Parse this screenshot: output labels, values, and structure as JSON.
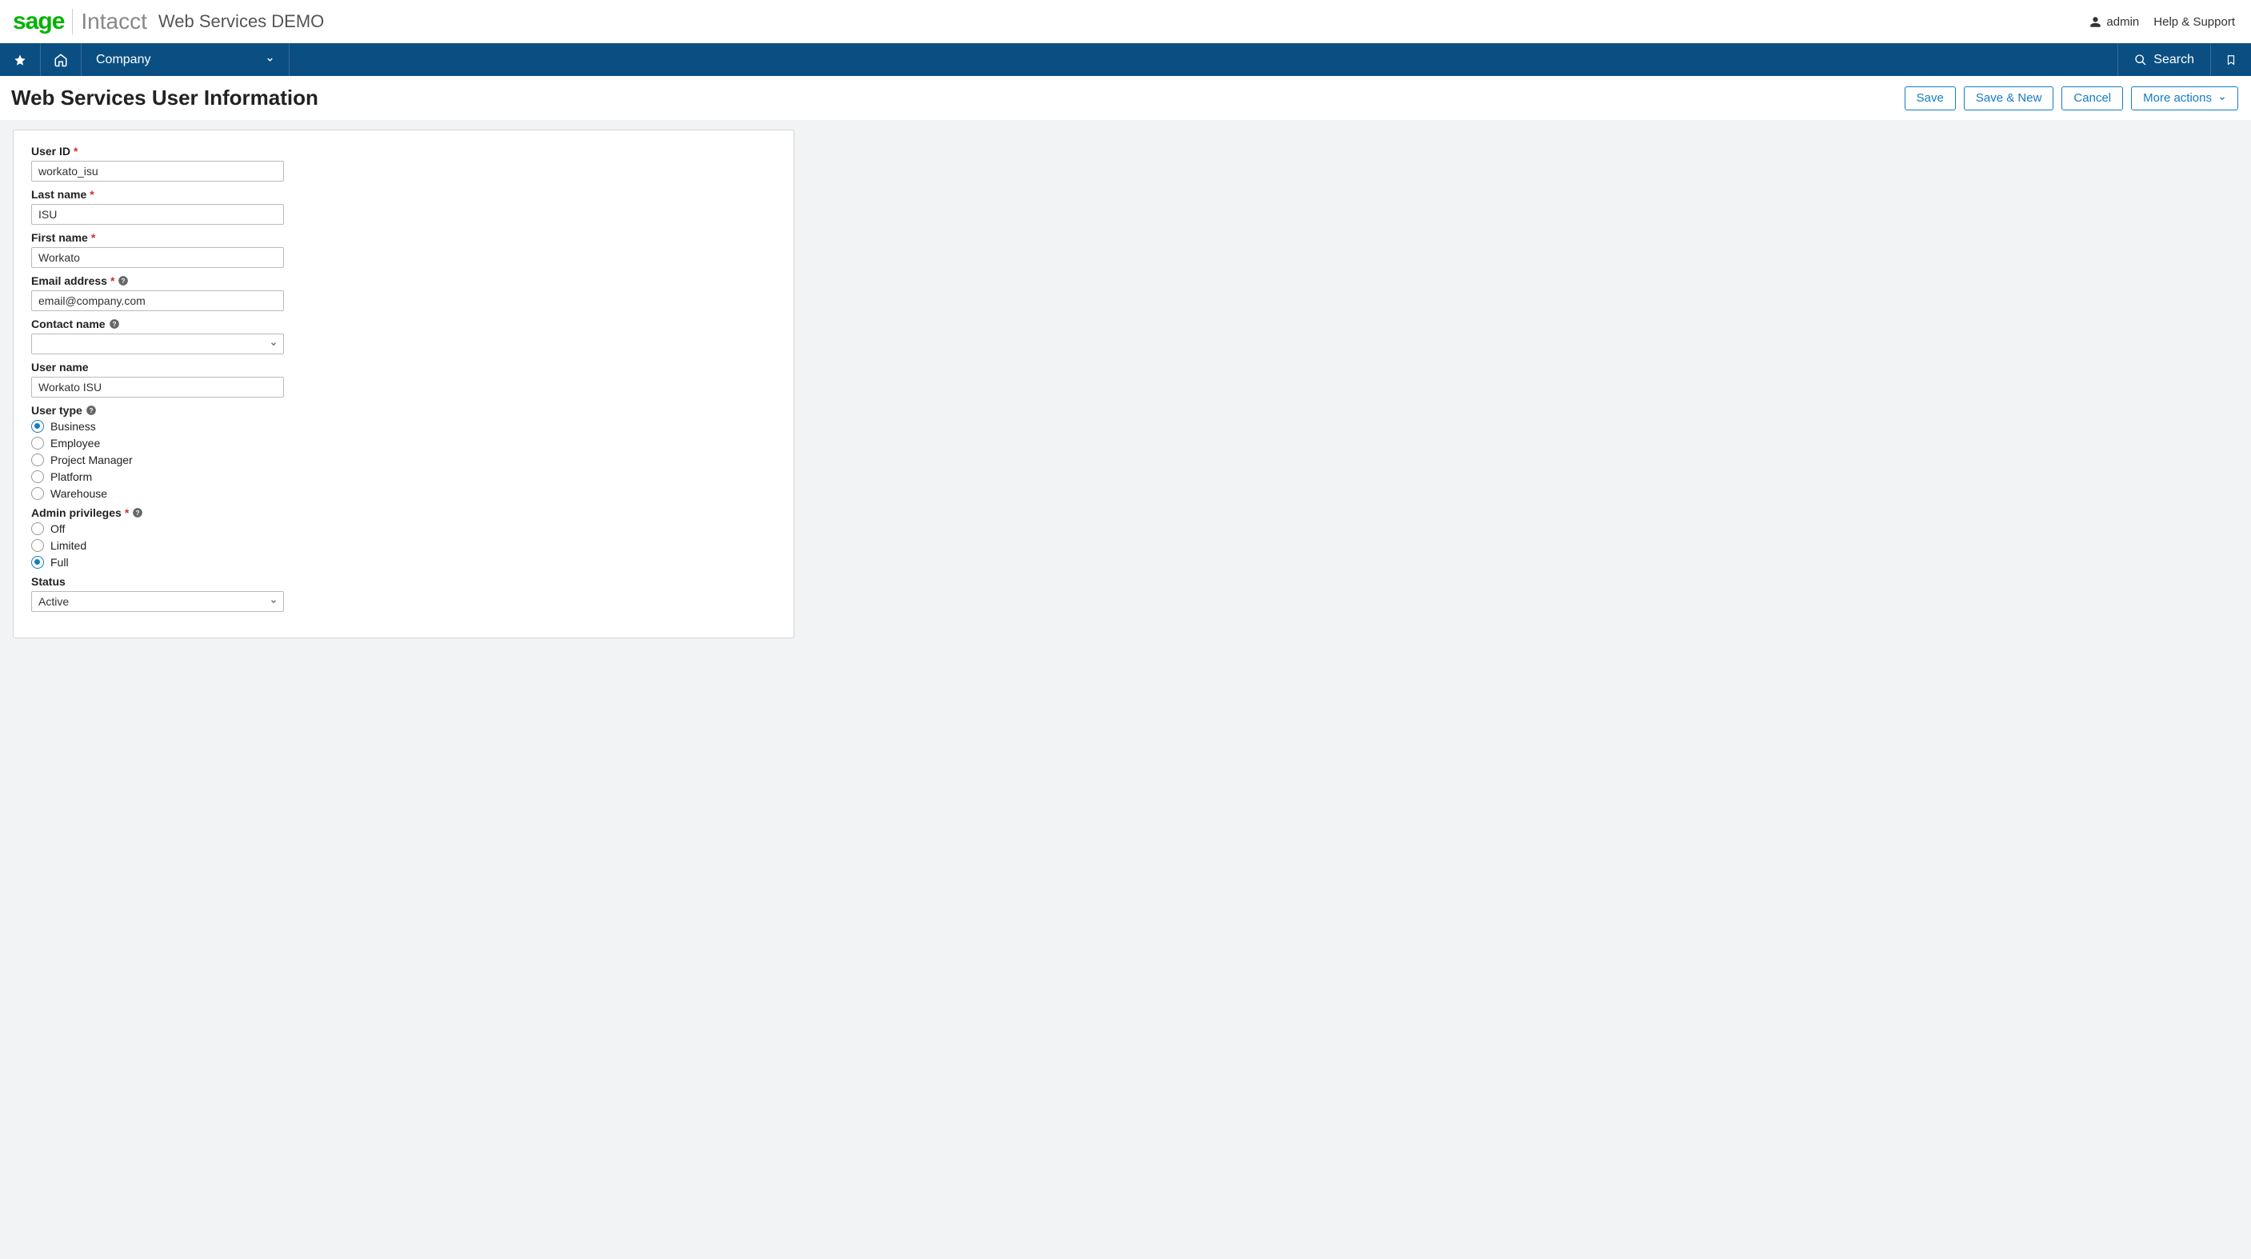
{
  "header": {
    "logo_sage": "sage",
    "logo_intacct": "Intacct",
    "company_name": "Web Services DEMO",
    "user_name": "admin",
    "help_label": "Help & Support"
  },
  "nav": {
    "active_module": "Company",
    "search_label": "Search"
  },
  "page": {
    "title": "Web Services User Information",
    "actions": {
      "save": "Save",
      "save_new": "Save & New",
      "cancel": "Cancel",
      "more_actions": "More actions"
    }
  },
  "form": {
    "user_id": {
      "label": "User ID",
      "value": "workato_isu"
    },
    "last_name": {
      "label": "Last name",
      "value": "ISU"
    },
    "first_name": {
      "label": "First name",
      "value": "Workato"
    },
    "email": {
      "label": "Email address",
      "value": "email@company.com"
    },
    "contact_name": {
      "label": "Contact name",
      "value": ""
    },
    "user_name": {
      "label": "User name",
      "value": "Workato ISU"
    },
    "user_type": {
      "label": "User type",
      "options": [
        "Business",
        "Employee",
        "Project Manager",
        "Platform",
        "Warehouse"
      ],
      "selected": "Business"
    },
    "admin_privileges": {
      "label": "Admin privileges",
      "options": [
        "Off",
        "Limited",
        "Full"
      ],
      "selected": "Full"
    },
    "status": {
      "label": "Status",
      "value": "Active"
    }
  }
}
